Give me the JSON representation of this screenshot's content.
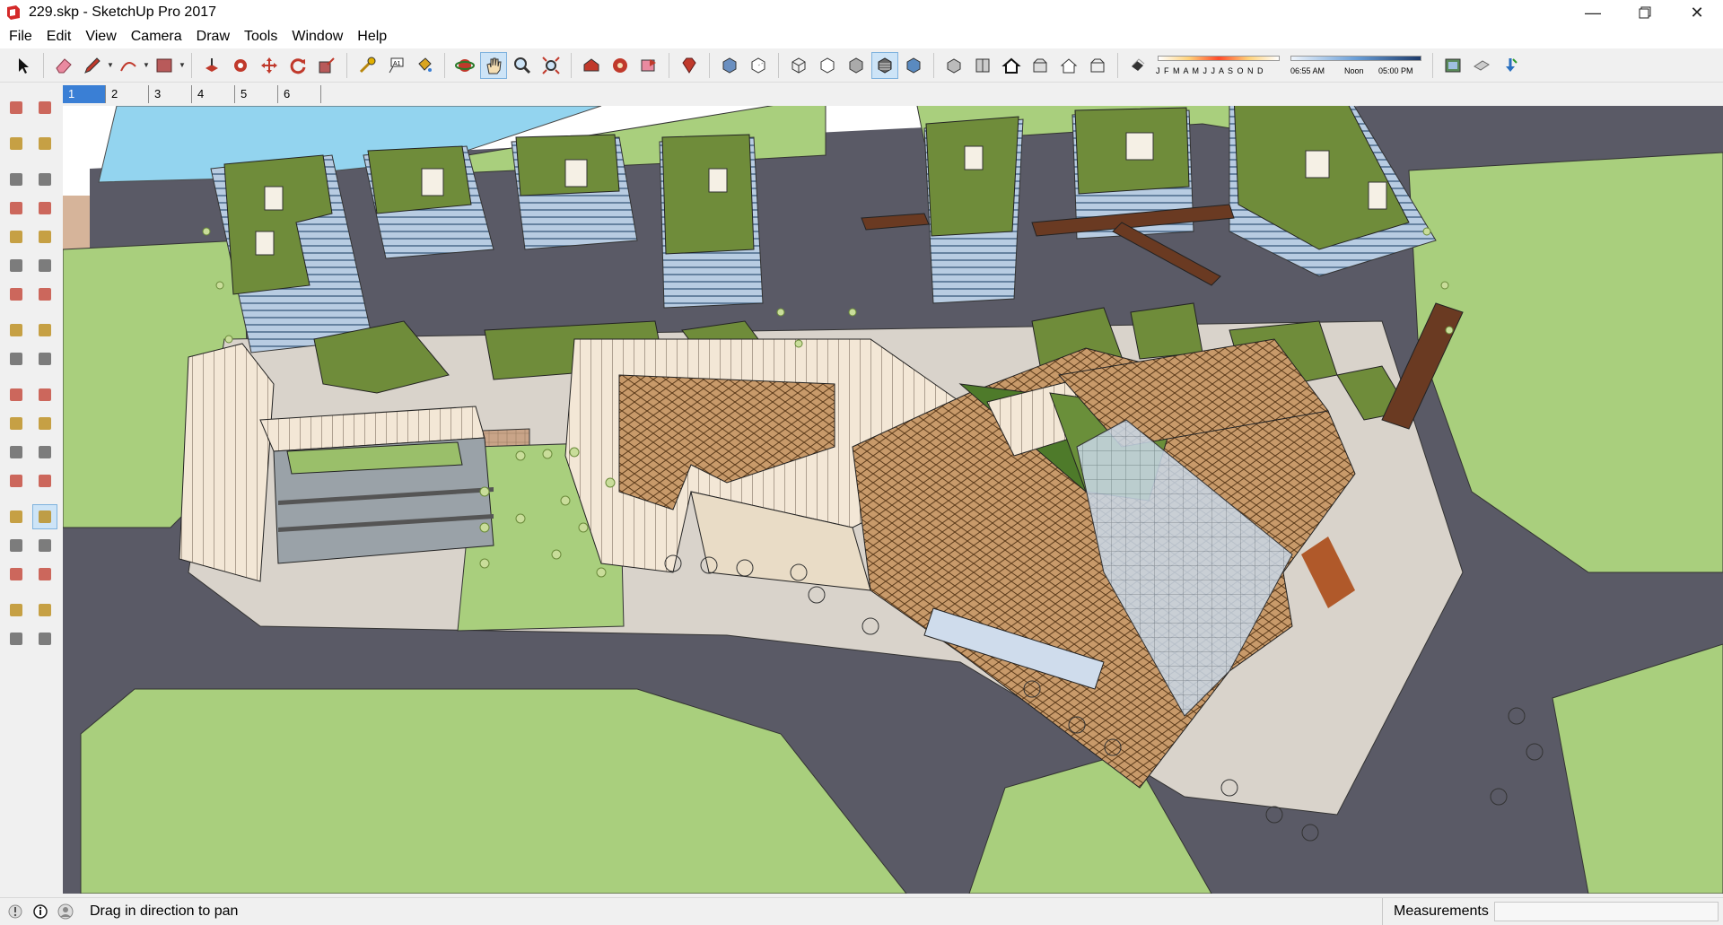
{
  "window": {
    "title": "229.skp - SketchUp Pro 2017",
    "minimize_icon": "minimize-icon",
    "restore_icon": "restore-icon",
    "close_icon": "close-icon"
  },
  "menu": {
    "items": [
      "File",
      "Edit",
      "View",
      "Camera",
      "Draw",
      "Tools",
      "Window",
      "Help"
    ]
  },
  "toolbar": {
    "icons": [
      "select-icon",
      "eraser-icon",
      "pencil-icon",
      "arc-icon",
      "rectangle-icon",
      "push-pull-icon",
      "follow-me-icon",
      "move-icon",
      "rotate-icon",
      "scale-icon",
      "tape-measure-icon",
      "text-icon",
      "paint-bucket-icon",
      "orbit-icon",
      "pan-icon",
      "zoom-icon",
      "zoom-extents-icon",
      "warehouse-icon",
      "extension-warehouse-icon",
      "share-model-icon",
      "ruby-console-icon",
      "xray-icon",
      "back-edges-icon",
      "wireframe-icon",
      "hidden-line-icon",
      "shaded-icon",
      "shaded-textures-icon",
      "monochrome-icon",
      "iso-view-icon",
      "top-view-icon",
      "front-view-icon",
      "right-view-icon",
      "back-view-icon",
      "left-view-icon",
      "shadows-icon",
      "photo-texture-icon",
      "add-location-icon",
      "sandbox-icon"
    ],
    "months": "J F M A M J J A S O N D",
    "time_start": "06:55 AM",
    "time_mid": "Noon",
    "time_end": "05:00 PM",
    "pan_active": true
  },
  "scene_tabs": [
    "1",
    "2",
    "3",
    "4",
    "5",
    "6"
  ],
  "active_scene": "1",
  "palette": {
    "icons": [
      "select-icon",
      "component-icon",
      "paint-bucket-icon",
      "eraser-icon",
      "line-icon",
      "freehand-icon",
      "rectangle-icon",
      "rotated-rectangle-icon",
      "circle-icon",
      "polygon-icon",
      "arc-icon",
      "two-point-arc-icon",
      "three-point-arc-icon",
      "pie-icon",
      "move-icon",
      "push-pull-icon",
      "rotate-icon",
      "follow-me-icon",
      "scale-icon",
      "offset-icon",
      "tape-measure-icon",
      "dimension-icon",
      "protractor-icon",
      "text-icon",
      "axes-icon",
      "3d-text-icon",
      "orbit-icon",
      "pan-icon",
      "zoom-icon",
      "zoom-window-icon",
      "zoom-extents-icon",
      "previous-view-icon",
      "position-camera-icon",
      "look-around-icon",
      "walk-icon",
      "section-plane-icon"
    ]
  },
  "status": {
    "hint": "Drag in direction to pan",
    "measurements_label": "Measurements",
    "measurements_value": ""
  }
}
